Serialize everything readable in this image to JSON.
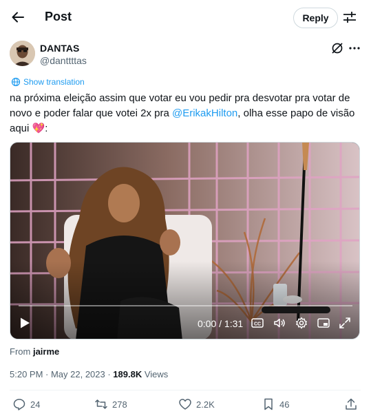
{
  "header": {
    "title": "Post",
    "reply_label": "Reply"
  },
  "author": {
    "name": "DANTAS",
    "handle": "@danttttas"
  },
  "translate_label": "Show translation",
  "tweet": {
    "text_before": "na próxima eleição assim que votar eu vou pedir pra desvotar pra votar de novo e poder falar que votei 2x pra ",
    "mention": "@ErikakHilton",
    "text_after": ", olha esse papo de visão aqui ",
    "emoji": "💖",
    "text_end": ":"
  },
  "video": {
    "time": "0:00 / 1:31",
    "progress": 0
  },
  "source": {
    "prefix": "From",
    "name": "jairme"
  },
  "meta": {
    "timestamp": "5:20 PM · May 22, 2023 · ",
    "views_count": "189.8K",
    "views_label": " Views"
  },
  "actions": {
    "replies": "24",
    "reposts": "278",
    "likes": "2.2K",
    "bookmarks": "46"
  },
  "colors": {
    "accent": "#1d9bf0",
    "text": "#0f1419",
    "muted": "#536471"
  }
}
